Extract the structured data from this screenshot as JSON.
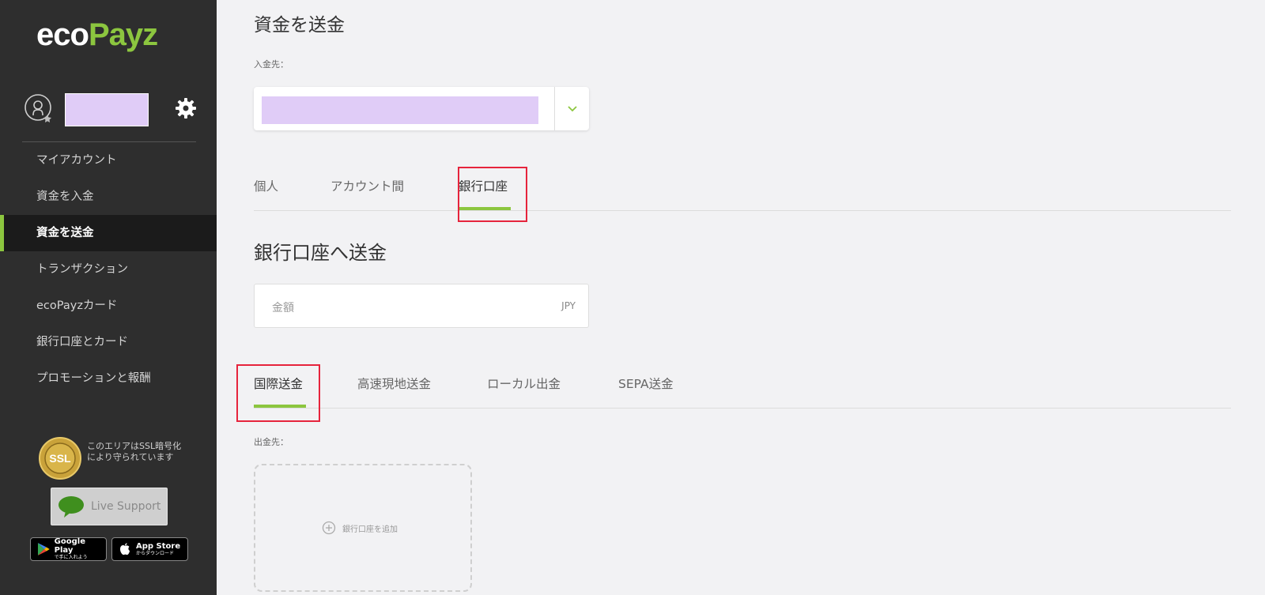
{
  "logo": {
    "part1": "eco",
    "part2": "Payz"
  },
  "sidebar": {
    "nav": [
      {
        "label": "マイアカウント"
      },
      {
        "label": "資金を入金"
      },
      {
        "label": "資金を送金"
      },
      {
        "label": "トランザクション"
      },
      {
        "label": "ecoPayzカード"
      },
      {
        "label": "銀行口座とカード"
      },
      {
        "label": "プロモーションと報酬"
      }
    ],
    "active_index": 2,
    "ssl_badge": "SSL",
    "ssl_text": "このエリアはSSL暗号化により守られています",
    "live_support": "Live Support",
    "google_play": {
      "title": "Google Play",
      "sub": "で手に入れよう"
    },
    "app_store": {
      "title": "App Store",
      "sub": "からダウンロード"
    }
  },
  "main": {
    "page_title": "資金を送金",
    "deposit_to_label": "入金先：",
    "transfer_tabs": [
      {
        "label": "個人"
      },
      {
        "label": "アカウント間"
      },
      {
        "label": "銀行口座"
      }
    ],
    "transfer_tabs_active": 2,
    "section_title": "銀行口座へ送金",
    "amount": {
      "placeholder": "金額",
      "currency": "JPY"
    },
    "method_tabs": [
      {
        "label": "国際送金"
      },
      {
        "label": "高速現地送金"
      },
      {
        "label": "ローカル出金"
      },
      {
        "label": "SEPA送金"
      }
    ],
    "method_tabs_active": 0,
    "withdraw_to_label": "出金先：",
    "add_bank_label": "銀行口座を追加"
  },
  "colors": {
    "accent": "#8cc63f",
    "sidebar_bg": "#2e2e2e",
    "highlight": "#e6243c",
    "redacted": "#e0ccf7"
  }
}
